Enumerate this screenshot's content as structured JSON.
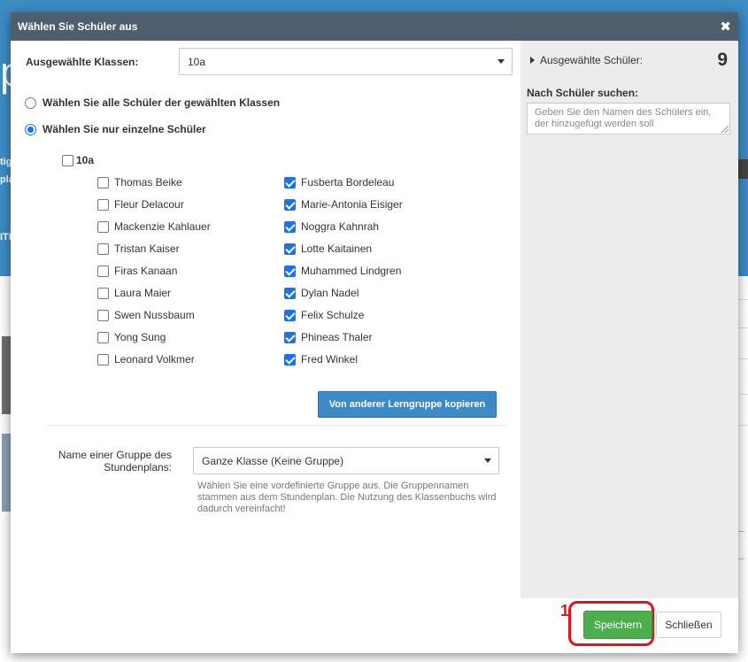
{
  "background": {
    "big_letter": "p",
    "line1": "tig",
    "line2": "pla",
    "line3": "ITI"
  },
  "modal": {
    "title": "Wählen Sie Schüler aus",
    "close_glyph": "✖",
    "class_label": "Ausgewählte Klassen:",
    "class_value": "10a",
    "radio_all": "Wählen Sie alle Schüler der gewählten Klassen",
    "radio_single": "Wählen Sie nur einzelne Schüler",
    "radio_single_selected": true,
    "class_group": "10a",
    "students_left": [
      {
        "name": "Thomas Beike",
        "checked": false
      },
      {
        "name": "Fleur Delacour",
        "checked": false
      },
      {
        "name": "Mackenzie Kahlauer",
        "checked": false
      },
      {
        "name": "Tristan Kaiser",
        "checked": false
      },
      {
        "name": "Firas Kanaan",
        "checked": false
      },
      {
        "name": "Laura Maier",
        "checked": false
      },
      {
        "name": "Swen Nussbaum",
        "checked": false
      },
      {
        "name": "Yong Sung",
        "checked": false
      },
      {
        "name": "Leonard Volkmer",
        "checked": false
      }
    ],
    "students_right": [
      {
        "name": "Fusberta Bordeleau",
        "checked": true
      },
      {
        "name": "Marie-Antonia Eisiger",
        "checked": true
      },
      {
        "name": "Noggra Kahnrah",
        "checked": true
      },
      {
        "name": "Lotte Kaitainen",
        "checked": true
      },
      {
        "name": "Muhammed Lindgren",
        "checked": true
      },
      {
        "name": "Dylan Nadel",
        "checked": true
      },
      {
        "name": "Felix Schulze",
        "checked": true
      },
      {
        "name": "Phineas Thaler",
        "checked": true
      },
      {
        "name": "Fred Winkel",
        "checked": true
      }
    ],
    "copy_button": "Von anderer Lerngruppe kopieren",
    "group_label": "Name einer Gruppe des Stundenplans:",
    "group_value": "Ganze Klasse (Keine Gruppe)",
    "group_help": "Wählen Sie eine vordefinierte Gruppe aus. Die Gruppennamen stammen aus dem Stundenplan. Die Nutzung des Klassenbuchs wird dadurch vereinfacht!",
    "right_panel": {
      "selected_label": "Ausgewählte Schüler:",
      "selected_count": "9",
      "search_label": "Nach Schüler suchen:",
      "search_placeholder": "Geben Sie den Namen des Schülers ein, der hinzugefügt werden soll"
    },
    "footer": {
      "annotation_number": "1",
      "save_label": "Speichern",
      "close_label": "Schließen"
    }
  },
  "colors": {
    "header": "#4e5e6c",
    "primary_blue": "#3d8ac7",
    "success_green": "#4cae4c",
    "highlight_red": "#e0141e",
    "checkbox_blue": "#1a73e8"
  }
}
